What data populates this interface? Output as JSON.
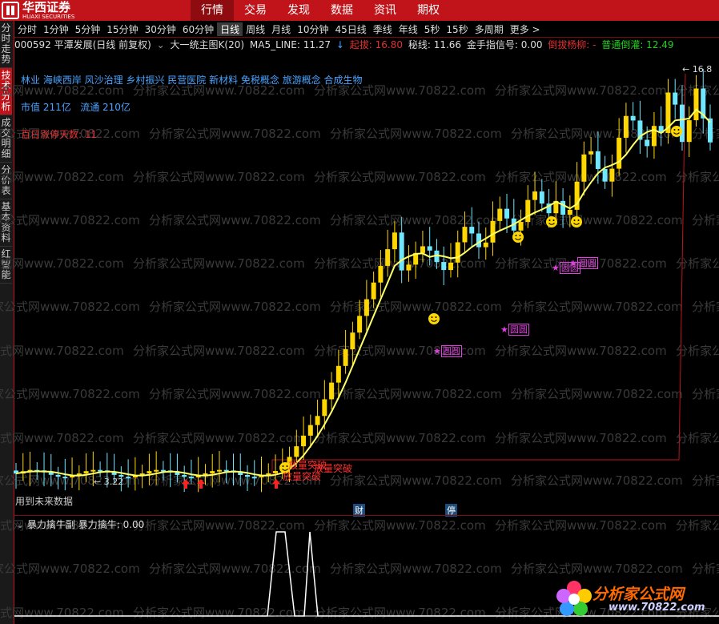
{
  "top_nav": {
    "logo_cn": "华西证券",
    "logo_en": "HUAXI SECURITIES",
    "items": [
      "行情",
      "交易",
      "发现",
      "数据",
      "资讯",
      "期权"
    ],
    "active": "行情"
  },
  "side_tabs": [
    "分时走势",
    "技术分析",
    "成交明细",
    "分价表",
    "基本资料",
    "红智能"
  ],
  "side_active": "技术分析",
  "periods": [
    "分时",
    "1分钟",
    "5分钟",
    "15分钟",
    "30分钟",
    "60分钟",
    "日线",
    "周线",
    "月线",
    "10分钟",
    "45日线",
    "季线",
    "年线",
    "5秒",
    "15秒",
    "多周期",
    "更多 >"
  ],
  "period_active": "日线",
  "info_bar": {
    "stock": "000592 平潭发展(日线 前复权)",
    "indicator": "大一统主图K(20)",
    "ma5_label": "MA5_LINE: 11.27",
    "arrow": "↓",
    "qiba": "起拔: 16.80",
    "mixian": "秘线: 11.66",
    "jinshou": "金手指信号: 0.00",
    "daoba": "倒拔杨柳: -",
    "putong": "普通倒灌: 12.49"
  },
  "overlay_text": {
    "concepts": "林业 海峡西岸 风沙治理 乡村振兴 民营医院 新材料 免税概念 旅游概念 合成生物",
    "market_cap": "市值 211亿",
    "float_cap": "流通 210亿",
    "limit_days": "百日涨停天数: 11",
    "future_data": "用到未来数据",
    "price_high": "16.8",
    "price_low": "3.22",
    "marker_cai": "财",
    "marker_ting": "停",
    "yuanyuan": "圆圆",
    "breakout1": "放量突破",
    "breakout2": "放量突破",
    "breakout3": "放量突破"
  },
  "lower_panel": {
    "title": "暴力擒牛副",
    "value": "暴力擒牛: 0.00"
  },
  "watermark": {
    "text": "分析家公式网www.70822.com",
    "brand": "分析家公式网",
    "url": "www.70822.com"
  },
  "colors": {
    "bg": "#000000",
    "brand_red": "#c0141a",
    "ma_line": "#ffff66",
    "candle_yellow": "#ffd700",
    "candle_magenta": "#e040e0",
    "candle_cyan": "#6fe7ff",
    "candle_red": "#ff2020",
    "candle_green": "#20e020",
    "concept_blue": "#4aa3ff"
  },
  "chart_data": {
    "type": "candlestick",
    "price_high": 16.8,
    "price_low": 3.22,
    "ma_label": "MA5_LINE",
    "ma_value": 11.27
  }
}
